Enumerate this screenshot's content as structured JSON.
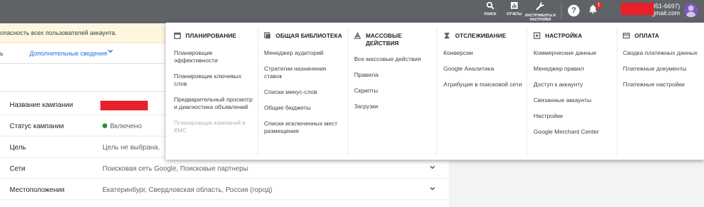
{
  "topbar": {
    "search_label": "ПОИСК",
    "reports_label": "ОТЧЕТЫ",
    "tools_label": "ИНСТРУМЕНТЫ И НАСТРОЙКИ",
    "help_icon": "help-icon",
    "notification_count": "!",
    "account_phone": "-951-6697)",
    "account_email": "gmail.com"
  },
  "warning": {
    "text": "опасность всех пользователей аккаунта."
  },
  "subnav": {
    "edge_text": "ь",
    "more_label": "Дополнительные сведения"
  },
  "settings": [
    {
      "name": "Название кампании",
      "value": ""
    },
    {
      "name": "Статус кампании",
      "value": "Включено"
    },
    {
      "name": "Цель",
      "value": "Цель не выбрана."
    },
    {
      "name": "Сети",
      "value": "Поисковая сеть Google, Поисковые партнеры"
    },
    {
      "name": "Местоположения",
      "value": "Екатеринбург, Свердловская область, Россия (город)"
    }
  ],
  "menu": {
    "columns": [
      {
        "title": "ПЛАНИРОВАНИЕ",
        "icon": "calendar-icon",
        "items": [
          {
            "label": "Планировщик эффективности",
            "disabled": false
          },
          {
            "label": "Планировщик ключевых слов",
            "disabled": false
          },
          {
            "label": "Предварительный просмотр и диагностика объявлений",
            "disabled": false
          },
          {
            "label": "Планировщик кампаний в КМС",
            "disabled": true
          }
        ]
      },
      {
        "title": "ОБЩАЯ БИБЛИОТЕКА",
        "icon": "library-icon",
        "items": [
          {
            "label": "Менеджер аудиторий",
            "disabled": false
          },
          {
            "label": "Стратегии назначения ставок",
            "disabled": false
          },
          {
            "label": "Списки минус-слов",
            "disabled": false
          },
          {
            "label": "Общие бюджеты",
            "disabled": false
          },
          {
            "label": "Списки исключенных мест размещения",
            "disabled": false
          }
        ]
      },
      {
        "title": "МАССОВЫЕ ДЕЙСТВИЯ",
        "icon": "bulk-actions-icon",
        "items": [
          {
            "label": "Все массовые действия",
            "disabled": false
          },
          {
            "label": "Правила",
            "disabled": false
          },
          {
            "label": "Скрипты",
            "disabled": false
          },
          {
            "label": "Загрузки",
            "disabled": false
          }
        ]
      },
      {
        "title": "ОТСЛЕЖИВАНИЕ",
        "icon": "hourglass-icon",
        "items": [
          {
            "label": "Конверсии",
            "disabled": false
          },
          {
            "label": "Google Аналитика",
            "disabled": false
          },
          {
            "label": "Атрибуция в поисковой сети",
            "disabled": false
          }
        ]
      },
      {
        "title": "НАСТРОЙКА",
        "icon": "settings-icon",
        "items": [
          {
            "label": "Коммерческие данные",
            "disabled": false
          },
          {
            "label": "Менеджер правил",
            "disabled": false
          },
          {
            "label": "Доступ к аккаунту",
            "disabled": false
          },
          {
            "label": "Связанные аккаунты",
            "disabled": false
          },
          {
            "label": "Настройки",
            "disabled": false
          },
          {
            "label": "Google Merchant Center",
            "disabled": false
          }
        ]
      },
      {
        "title": "ОПЛАТА",
        "icon": "credit-card-icon",
        "items": [
          {
            "label": "Сводка платежных данных",
            "disabled": false
          },
          {
            "label": "Платежные документы",
            "disabled": false
          },
          {
            "label": "Платежные настройки",
            "disabled": false
          }
        ]
      }
    ]
  },
  "colors": {
    "topbar": "#5f6368",
    "warning_bg": "#fef7e0",
    "link": "#1a73e8",
    "status_green": "#1e8e3e",
    "redaction": "#e8202a"
  }
}
